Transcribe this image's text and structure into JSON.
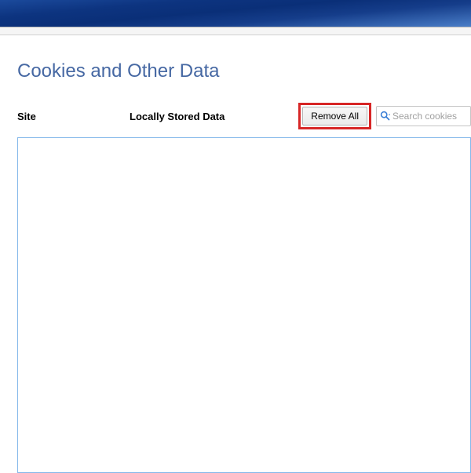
{
  "page": {
    "title": "Cookies and Other Data"
  },
  "columns": {
    "site": "Site",
    "locally_stored": "Locally Stored Data"
  },
  "toolbar": {
    "remove_all_label": "Remove All"
  },
  "search": {
    "placeholder": "Search cookies"
  }
}
